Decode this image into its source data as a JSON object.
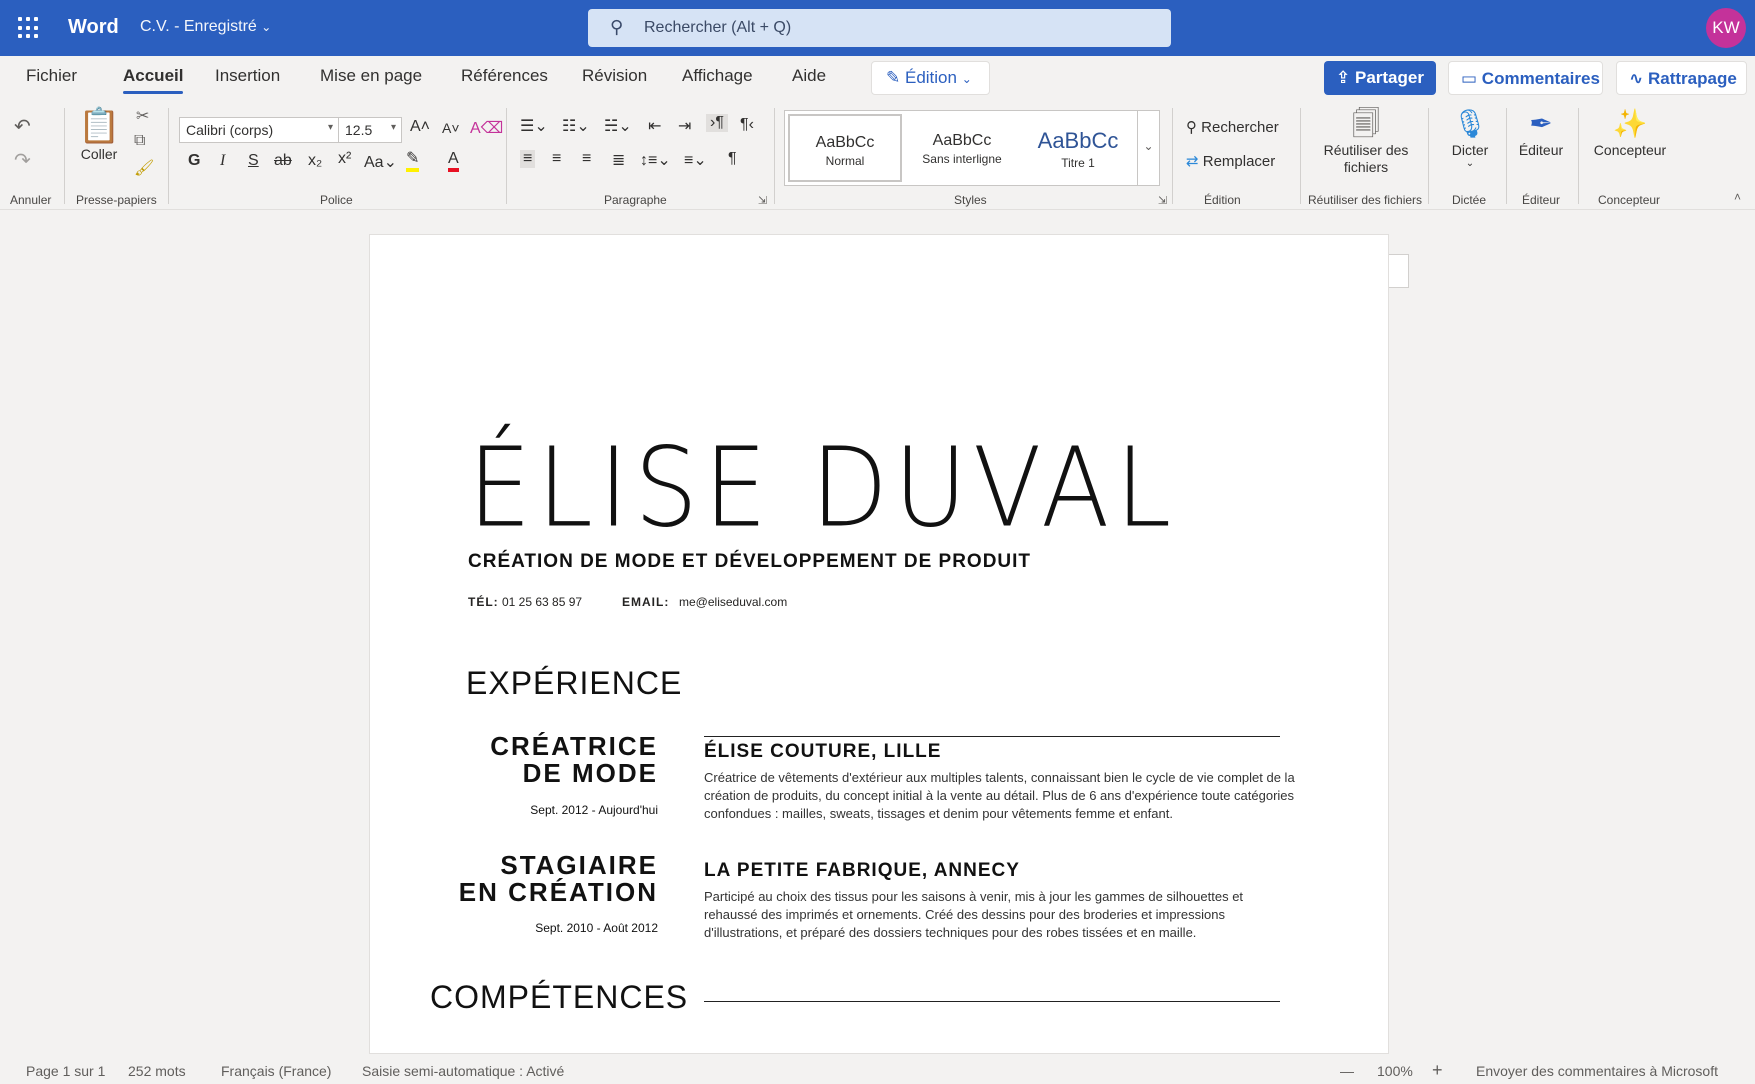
{
  "titlebar": {
    "app_name": "Word",
    "doc_name": "C.V. - Enregistré",
    "search_placeholder": "Rechercher (Alt + Q)",
    "user_initials": "KW"
  },
  "menu": {
    "tabs": [
      "Fichier",
      "Accueil",
      "Insertion",
      "Mise en page",
      "Références",
      "Révision",
      "Affichage",
      "Aide"
    ],
    "active_tab": "Accueil",
    "edit_mode": "Édition",
    "share": "Partager",
    "comments": "Commentaires",
    "catchup": "Rattrapage"
  },
  "ribbon": {
    "groups": {
      "undo": "Annuler",
      "clipboard": "Presse-papiers",
      "font": "Police",
      "paragraph": "Paragraphe",
      "styles": "Styles",
      "editing": "Édition",
      "reuse": "Réutiliser des fichiers",
      "dictate": "Dictée",
      "editor": "Éditeur",
      "designer": "Concepteur"
    },
    "paste": "Coller",
    "font_name": "Calibri (corps)",
    "font_size": "12.5",
    "styles": [
      {
        "sample": "AaBbCc",
        "name": "Normal"
      },
      {
        "sample": "AaBbCc",
        "name": "Sans interligne"
      },
      {
        "sample": "AaBbCc",
        "name": "Titre 1"
      }
    ],
    "find": "Rechercher",
    "replace": "Remplacer",
    "reuse_files": "Réutiliser des fichiers",
    "dictate": "Dicter",
    "editor": "Éditeur",
    "designer": "Concepteur",
    "accent_color": "#2b5fbf"
  },
  "document": {
    "name": "ÉLISE DUVAL",
    "subtitle": "CRÉATION DE MODE ET DÉVELOPPEMENT DE PRODUIT",
    "tel_label": "TÉL:",
    "tel": "01 25 63 85 97",
    "email_label": "EMAIL:",
    "email": "me@eliseduval.com",
    "experience_title": "EXPÉRIENCE",
    "jobs": [
      {
        "title_line1": "CRÉATRICE",
        "title_line2": "DE MODE",
        "dates": "Sept. 2012 - Aujourd'hui",
        "company": "ÉLISE COUTURE, LILLE",
        "description": "Créatrice de vêtements d'extérieur aux multiples talents, connaissant bien le cycle de vie complet de la création de produits, du concept initial à la vente au détail. Plus de 6 ans d'expérience toute catégories confondues : mailles, sweats, tissages et denim pour vêtements femme et enfant."
      },
      {
        "title_line1": "STAGIAIRE",
        "title_line2": "EN CRÉATION",
        "dates": "Sept. 2010 - Août 2012",
        "company": "LA PETITE FABRIQUE, ANNECY",
        "description": "Participé au choix des tissus pour les saisons à venir, mis à jour les gammes de silhouettes et rehaussé des imprimés et ornements. Créé des dessins pour des broderies et impressions d'illustrations, et préparé des dossiers techniques pour des robes tissées et en maille."
      }
    ],
    "skills_title": "COMPÉTENCES"
  },
  "status": {
    "page": "Page 1 sur 1",
    "words": "252 mots",
    "language": "Français (France)",
    "autocomplete": "Saisie semi-automatique : Activé",
    "zoom_out": "—",
    "zoom": "100%",
    "zoom_in": "+",
    "feedback": "Envoyer des commentaires à Microsoft"
  }
}
